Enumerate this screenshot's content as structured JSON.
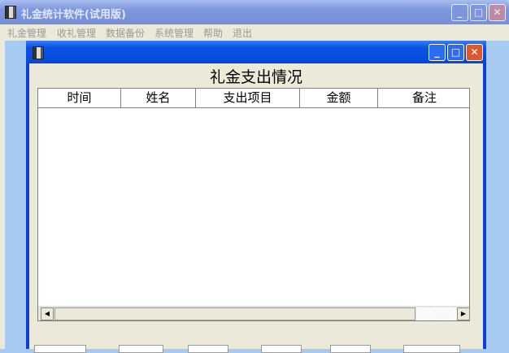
{
  "app": {
    "title": "礼金统计软件(试用版)"
  },
  "menu": [
    "礼金管理",
    "收礼管理",
    "数据备份",
    "系统管理",
    "帮助",
    "退出"
  ],
  "child": {
    "heading": "礼金支出情况",
    "columns": [
      "时间",
      "姓名",
      "支出项目",
      "金额",
      "备注"
    ]
  },
  "icons": {
    "min": "minimize-icon",
    "max": "maximize-icon",
    "close": "close-icon"
  }
}
